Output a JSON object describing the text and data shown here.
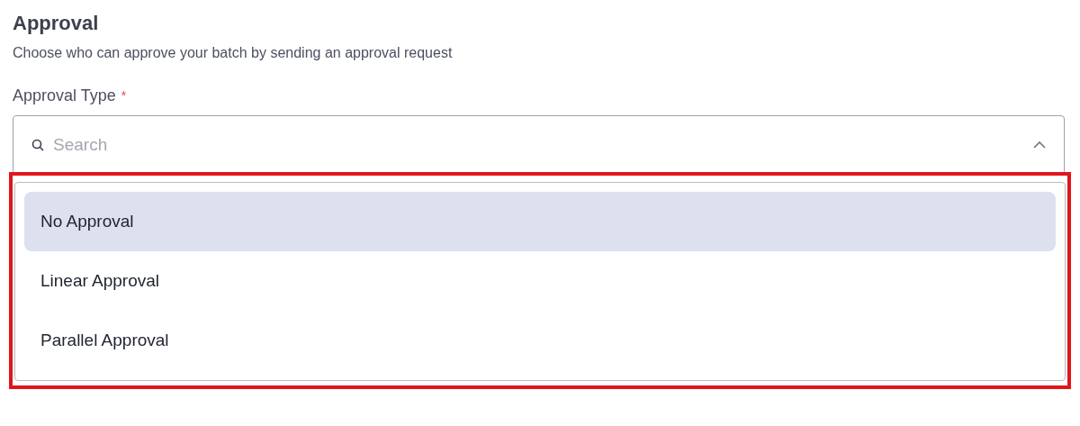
{
  "section": {
    "title": "Approval",
    "subtitle": "Choose who can approve your batch by sending an approval request"
  },
  "field": {
    "label": "Approval Type",
    "required_mark": "*",
    "placeholder": "Search",
    "expanded": true,
    "options": [
      {
        "label": "No Approval",
        "selected": true
      },
      {
        "label": "Linear Approval",
        "selected": false
      },
      {
        "label": "Parallel Approval",
        "selected": false
      }
    ]
  }
}
